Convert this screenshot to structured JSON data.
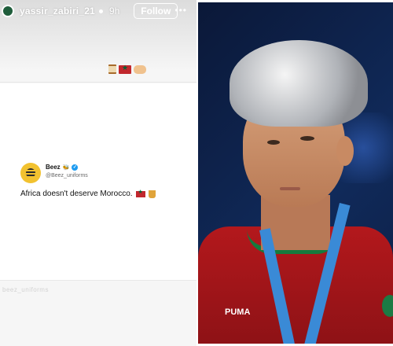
{
  "story": {
    "username": "yassir_zabiri_21",
    "time": "9h",
    "follow_label": "Follow",
    "more_icon": "more-dots-icon",
    "watermark": "beez_uniforms"
  },
  "tweet": {
    "name": "Beez",
    "handle": "@Beez_uniforms",
    "text": "Africa doesn't deserve Morocco."
  },
  "colors": {
    "verified": "#1d9bf0",
    "morocco_red": "#c1272d",
    "morocco_green": "#006233",
    "avatar_yellow": "#f2c230"
  }
}
